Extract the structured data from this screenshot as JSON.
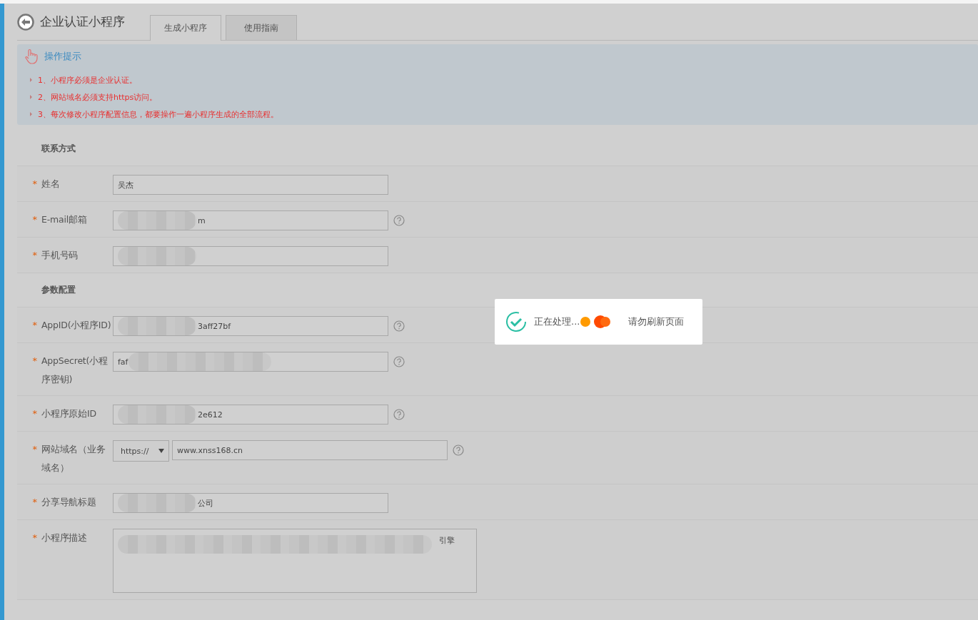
{
  "header": {
    "title": "企业认证小程序"
  },
  "tabs": [
    {
      "label": "生成小程序",
      "selected": true
    },
    {
      "label": "使用指南",
      "selected": false
    }
  ],
  "tips": {
    "title": "操作提示",
    "items": [
      "1、小程序必须是企业认证。",
      "2、网站域名必须支持https访问。",
      "3、每次修改小程序配置信息，都要操作一遍小程序生成的全部流程。"
    ]
  },
  "sections": [
    {
      "title": "联系方式",
      "rows": [
        {
          "label": "姓名",
          "required": "*",
          "kind": "text",
          "help": false,
          "parts": [
            {
              "kind": "text",
              "text": "吴杰"
            }
          ]
        },
        {
          "label": "E-mail邮箱",
          "required": "*",
          "kind": "text",
          "help": true,
          "parts": [
            {
              "kind": "redacted"
            },
            {
              "kind": "text",
              "text": "m"
            }
          ]
        },
        {
          "label": "手机号码",
          "required": "*",
          "kind": "text",
          "help": false,
          "parts": [
            {
              "kind": "redacted"
            }
          ]
        }
      ]
    },
    {
      "title": "参数配置",
      "rows": [
        {
          "label": "AppID(小程序ID)",
          "required": "*",
          "kind": "text",
          "help": true,
          "parts": [
            {
              "kind": "redacted"
            },
            {
              "kind": "text",
              "text": "3aff27bf"
            }
          ]
        },
        {
          "label": "AppSecret(小程序密钥)",
          "required": "*",
          "kind": "text",
          "help": true,
          "parts": [
            {
              "kind": "text",
              "text": "faf"
            },
            {
              "kind": "redacted-wide"
            }
          ]
        },
        {
          "label": "小程序原始ID",
          "required": "*",
          "kind": "text",
          "help": true,
          "parts": [
            {
              "kind": "redacted"
            },
            {
              "kind": "text",
              "text": "2e612"
            }
          ]
        },
        {
          "label": "网站域名（业务域名）",
          "required": "*",
          "kind": "select-text",
          "help": true,
          "select": "https://",
          "parts": [
            {
              "kind": "text",
              "text": "www.xnss168.cn"
            }
          ]
        },
        {
          "label": "分享导航标题",
          "required": "*",
          "kind": "text",
          "help": false,
          "parts": [
            {
              "kind": "redacted"
            },
            {
              "kind": "text",
              "text": "公司"
            }
          ]
        },
        {
          "label": "小程序描述",
          "required": "*",
          "kind": "textarea",
          "help": false,
          "parts": [
            {
              "kind": "redacted-long"
            },
            {
              "kind": "text",
              "text": "引擎"
            }
          ]
        }
      ]
    }
  ],
  "toast": {
    "status": "正在处理...",
    "note": "请勿刷新页面"
  }
}
